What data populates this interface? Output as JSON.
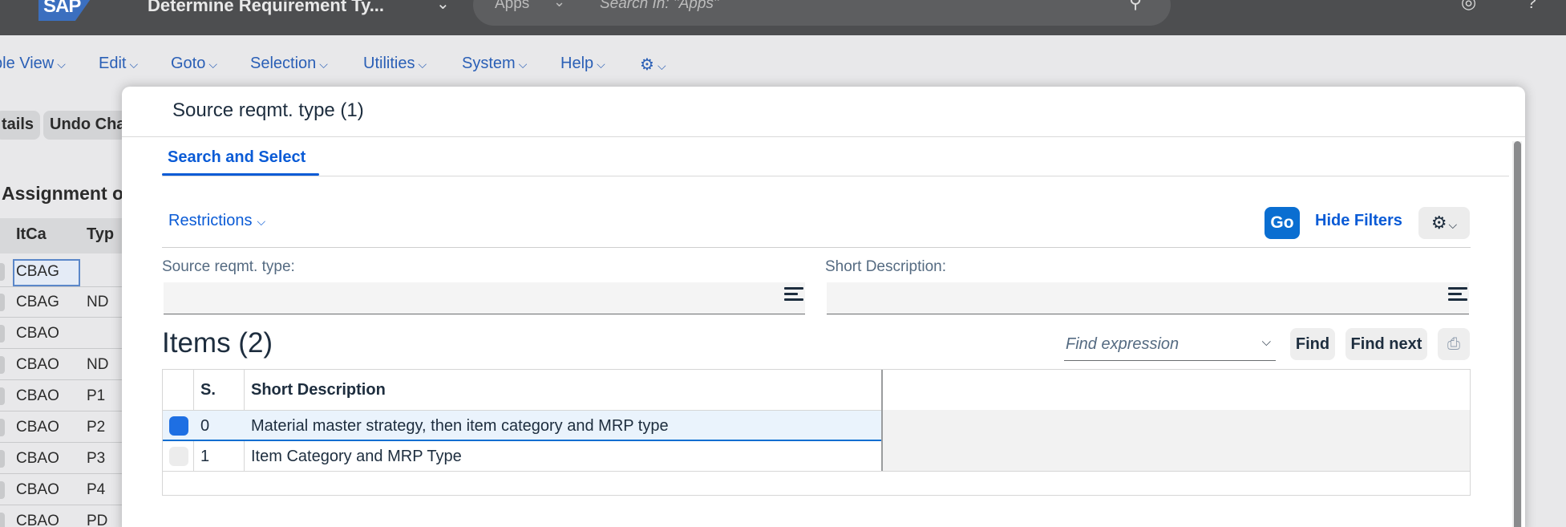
{
  "shell": {
    "logo": "SAP",
    "title": "Determine Requirement Ty...",
    "search_scope": "Apps",
    "search_placeholder": "Search In: \"Apps\""
  },
  "menubar": {
    "items": [
      {
        "label": "ble View"
      },
      {
        "label": "Edit"
      },
      {
        "label": "Goto"
      },
      {
        "label": "Selection"
      },
      {
        "label": "Utilities"
      },
      {
        "label": "System"
      },
      {
        "label": "Help"
      }
    ]
  },
  "background": {
    "buttons": [
      {
        "label": "tails"
      },
      {
        "label": "Undo Cha"
      }
    ],
    "heading": "Assignment o",
    "columns": [
      "ItCa",
      "Typ"
    ],
    "rows": [
      {
        "itca": "CBAG",
        "typ": ""
      },
      {
        "itca": "CBAG",
        "typ": "ND"
      },
      {
        "itca": "CBAO",
        "typ": ""
      },
      {
        "itca": "CBAO",
        "typ": "ND"
      },
      {
        "itca": "CBAO",
        "typ": "P1"
      },
      {
        "itca": "CBAO",
        "typ": "P2"
      },
      {
        "itca": "CBAO",
        "typ": "P3"
      },
      {
        "itca": "CBAO",
        "typ": "P4"
      },
      {
        "itca": "CBAO",
        "typ": "PD"
      }
    ]
  },
  "dialog": {
    "title": "Source reqmt. type (1)",
    "tab": "Search and Select",
    "restrictions_label": "Restrictions",
    "go_label": "Go",
    "hide_filters_label": "Hide Filters",
    "filters": [
      {
        "label": "Source reqmt. type:",
        "value": ""
      },
      {
        "label": "Short Description:",
        "value": ""
      }
    ],
    "items_title": "Items (2)",
    "find_placeholder": "Find expression",
    "find_label": "Find",
    "find_next_label": "Find next",
    "table": {
      "columns": [
        "S.",
        "Short Description"
      ],
      "rows": [
        {
          "s": "0",
          "description": "Material master strategy, then item category and MRP type",
          "selected": true
        },
        {
          "s": "1",
          "description": "Item Category and MRP Type",
          "selected": false
        }
      ]
    }
  },
  "colors": {
    "accent": "#0a6ed1",
    "link": "#0a5bd6",
    "shell": "#4d4e50"
  }
}
